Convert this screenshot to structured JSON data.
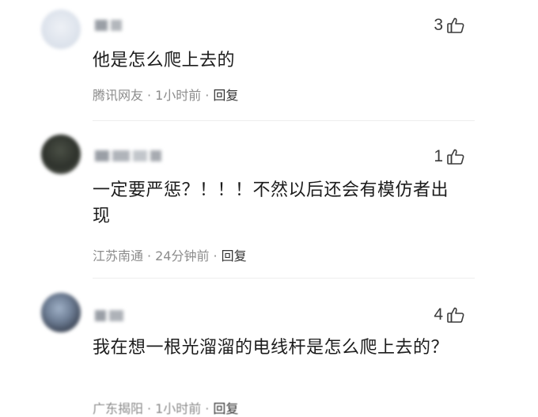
{
  "comments": [
    {
      "likes": "3",
      "text": "他是怎么爬上去的",
      "location": "腾讯网友",
      "time": "1小时前",
      "reply_label": "回复"
    },
    {
      "likes": "1",
      "text": "一定要严惩？！！！不然以后还会有模仿者出现",
      "location": "江苏南通",
      "time": "24分钟前",
      "reply_label": "回复"
    },
    {
      "likes": "4",
      "text": "我在想一根光溜溜的电线杆是怎么爬上去的？",
      "location": "广东揭阳",
      "time": "1小时前",
      "reply_label": "回复"
    }
  ],
  "separator": "·",
  "icons": {
    "like": "thumbs-up-icon",
    "avatar": "avatar"
  },
  "colors": {
    "meta": "#8c8c8c",
    "text": "#1c1c1c",
    "reply": "#333333"
  }
}
